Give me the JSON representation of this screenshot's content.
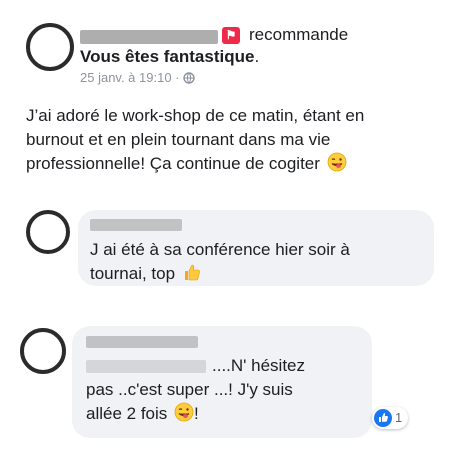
{
  "post": {
    "action_text": "recommande",
    "recommendation_title": "Vous êtes fantastique",
    "title_suffix": ".",
    "timestamp": "25 janv. à 19:10",
    "separator": "·",
    "body_lines": [
      "J’ai adoré le work-shop de ce matin, étant en",
      "burnout et en plein tournant dans ma vie",
      "professionnelle! Ça continue de cogiter"
    ],
    "colors": {
      "recommend_icon": "#f02849",
      "bubble_bg": "#f0f2f5",
      "like_blue": "#1877f2"
    }
  },
  "comments": [
    {
      "lines": [
        "J ai été à sa conférence hier soir à",
        "tournai, top"
      ],
      "emoji": "thumbs-up-emoji"
    },
    {
      "first_line_suffix": "....N' hésitez",
      "lines": [
        "pas ..c'est super ...! J'y suis",
        "allée 2 fois"
      ],
      "end_text": "!",
      "emoji": "winking-tongue-emoji",
      "reaction_count": "1"
    }
  ]
}
